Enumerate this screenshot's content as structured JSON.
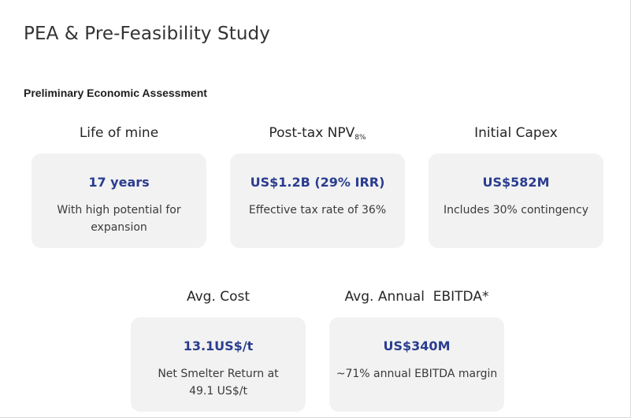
{
  "page": {
    "title": "PEA & Pre-Feasibility Study",
    "section_title": "Preliminary Economic Assessment"
  },
  "metrics": [
    {
      "heading": "Life of mine",
      "value": "17 years",
      "description": "With high potential for expansion"
    },
    {
      "heading": "Post-tax NPV",
      "heading_subscript": "8%",
      "value": "US$1.2B (29% IRR)",
      "description": "Effective tax rate of 36%"
    },
    {
      "heading": "Initial Capex",
      "value": "US$582M",
      "description": "Includes 30% contingency"
    },
    {
      "heading": "Avg. Cost",
      "value": "13.1US$/t",
      "description": "Net Smelter Return at 49.1 US$/t"
    },
    {
      "heading": "Avg. Annual  EBITDA*",
      "value": "US$340M",
      "description": "~71% annual EBITDA margin"
    }
  ],
  "colors": {
    "value_text": "#2a3d8f",
    "card_background": "#f2f2f2"
  }
}
